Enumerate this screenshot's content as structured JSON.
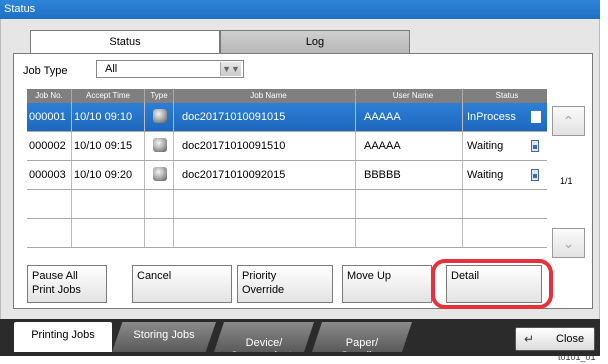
{
  "window": {
    "title": "Status"
  },
  "tabs": [
    {
      "label": "Status"
    },
    {
      "label": "Log"
    }
  ],
  "filter": {
    "label": "Job Type",
    "value": "All"
  },
  "table": {
    "headers": [
      "Job No.",
      "Accept Time",
      "Type",
      "Job Name",
      "User Name",
      "Status"
    ],
    "rows": [
      {
        "job_no": "000001",
        "time": "10/10 09:10",
        "type_icon": "printer-icon",
        "name": "doc20171010091015",
        "user": "AAAAA",
        "status": "InProcess"
      },
      {
        "job_no": "000002",
        "time": "10/10 09:15",
        "type_icon": "printer-icon",
        "name": "doc20171010091510",
        "user": "AAAAA",
        "status": "Waiting"
      },
      {
        "job_no": "000003",
        "time": "10/10 09:20",
        "type_icon": "printer-icon",
        "name": "doc20171010092015",
        "user": "BBBBB",
        "status": "Waiting"
      }
    ],
    "page_indicator": "1/1"
  },
  "actions": {
    "pause_all": "Pause All\nPrint Jobs",
    "cancel": "Cancel",
    "priority_override": "Priority\nOverride",
    "move_up": "Move Up",
    "detail": "Detail"
  },
  "bottom_tabs": {
    "printing": "Printing Jobs",
    "storing": "Storing Jobs",
    "device": "Device/\nCommunicate",
    "paper": "Paper/\nSupplies"
  },
  "close": {
    "label": "Close"
  },
  "caption": "t0101_01",
  "colors": {
    "accent": "#1f6fc3",
    "highlight": "#e8303a"
  }
}
